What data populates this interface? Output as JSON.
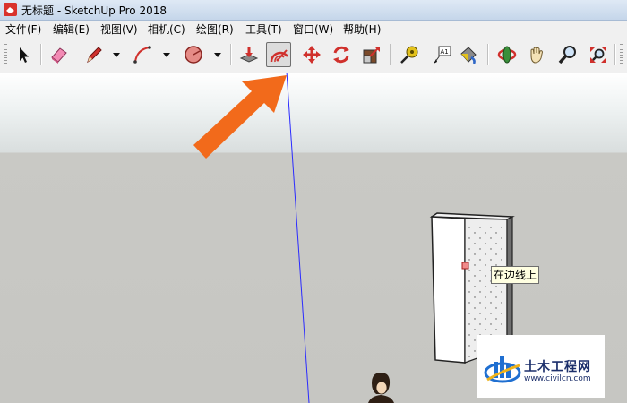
{
  "window": {
    "title": "无标题 - SketchUp Pro 2018"
  },
  "menu": [
    "文件(F)",
    "编辑(E)",
    "视图(V)",
    "相机(C)",
    "绘图(R)",
    "工具(T)",
    "窗口(W)",
    "帮助(H)"
  ],
  "toolbar": {
    "active_tool": "protractor",
    "tools": [
      "select-icon",
      "eraser-icon",
      "pencil-icon",
      "arc-icon",
      "polygon-icon",
      "push-pull-icon",
      "protractor-icon",
      "move-icon",
      "rotate-icon",
      "scale-icon",
      "tape-measure-icon",
      "text-icon",
      "paint-bucket-icon",
      "orbit-icon",
      "pan-icon",
      "zoom-icon",
      "zoom-extents-icon"
    ]
  },
  "viewport": {
    "inference_tooltip": "在边线上"
  },
  "watermark": {
    "brand": "土木工程网",
    "url": "www.civilcn.com"
  },
  "colors": {
    "annotation_arrow": "#f26a1b",
    "axis_line": "#2b2bff",
    "tooltip_bg": "#ffffe1"
  }
}
